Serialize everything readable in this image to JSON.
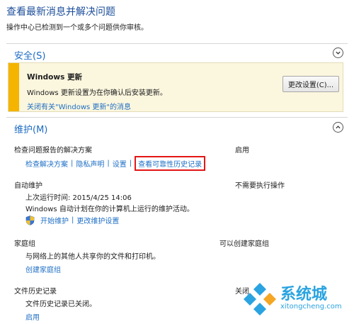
{
  "header": {
    "title": "查看最新消息并解决问题",
    "subtitle": "操作中心已检测到一个或多个问题供你审核。"
  },
  "security": {
    "title": "安全(S)",
    "alert": {
      "title": "Windows 更新",
      "text": "Windows 更新设置为在你确认后安装更新。",
      "link": "关闭有关\"Windows 更新\"的消息",
      "button": "更改设置(C)..."
    }
  },
  "maintenance": {
    "title": "维护(M)",
    "problem_reports": {
      "label": "检查问题报告的解决方案",
      "status": "启用",
      "links": [
        "检查解决方案",
        "隐私声明",
        "设置",
        "查看可靠性历史记录"
      ]
    },
    "auto_maintenance": {
      "label": "自动维护",
      "status": "不需要执行操作",
      "last_run": "上次运行时间: 2015/4/25 14:06",
      "description": "Windows 自动计划在你的计算机上运行的维护活动。",
      "links": [
        "开始维护",
        "更改维护设置"
      ]
    },
    "homegroup": {
      "label": "家庭组",
      "status": "可以创建家庭组",
      "description": "与网络上的其他人共享你的文件和打印机。",
      "link": "创建家庭组"
    },
    "file_history": {
      "label": "文件历史记录",
      "status": "关闭",
      "description": "文件历史记录已关闭。",
      "link": "启用"
    }
  },
  "watermark": {
    "brand": "系统城",
    "url": "xitongcheng.com"
  },
  "colors": {
    "link": "#1f6fc5",
    "title": "#1c4e9b",
    "alert_stripe": "#f5b400",
    "alert_bg": "#fbf6de",
    "highlight": "#e41616"
  }
}
